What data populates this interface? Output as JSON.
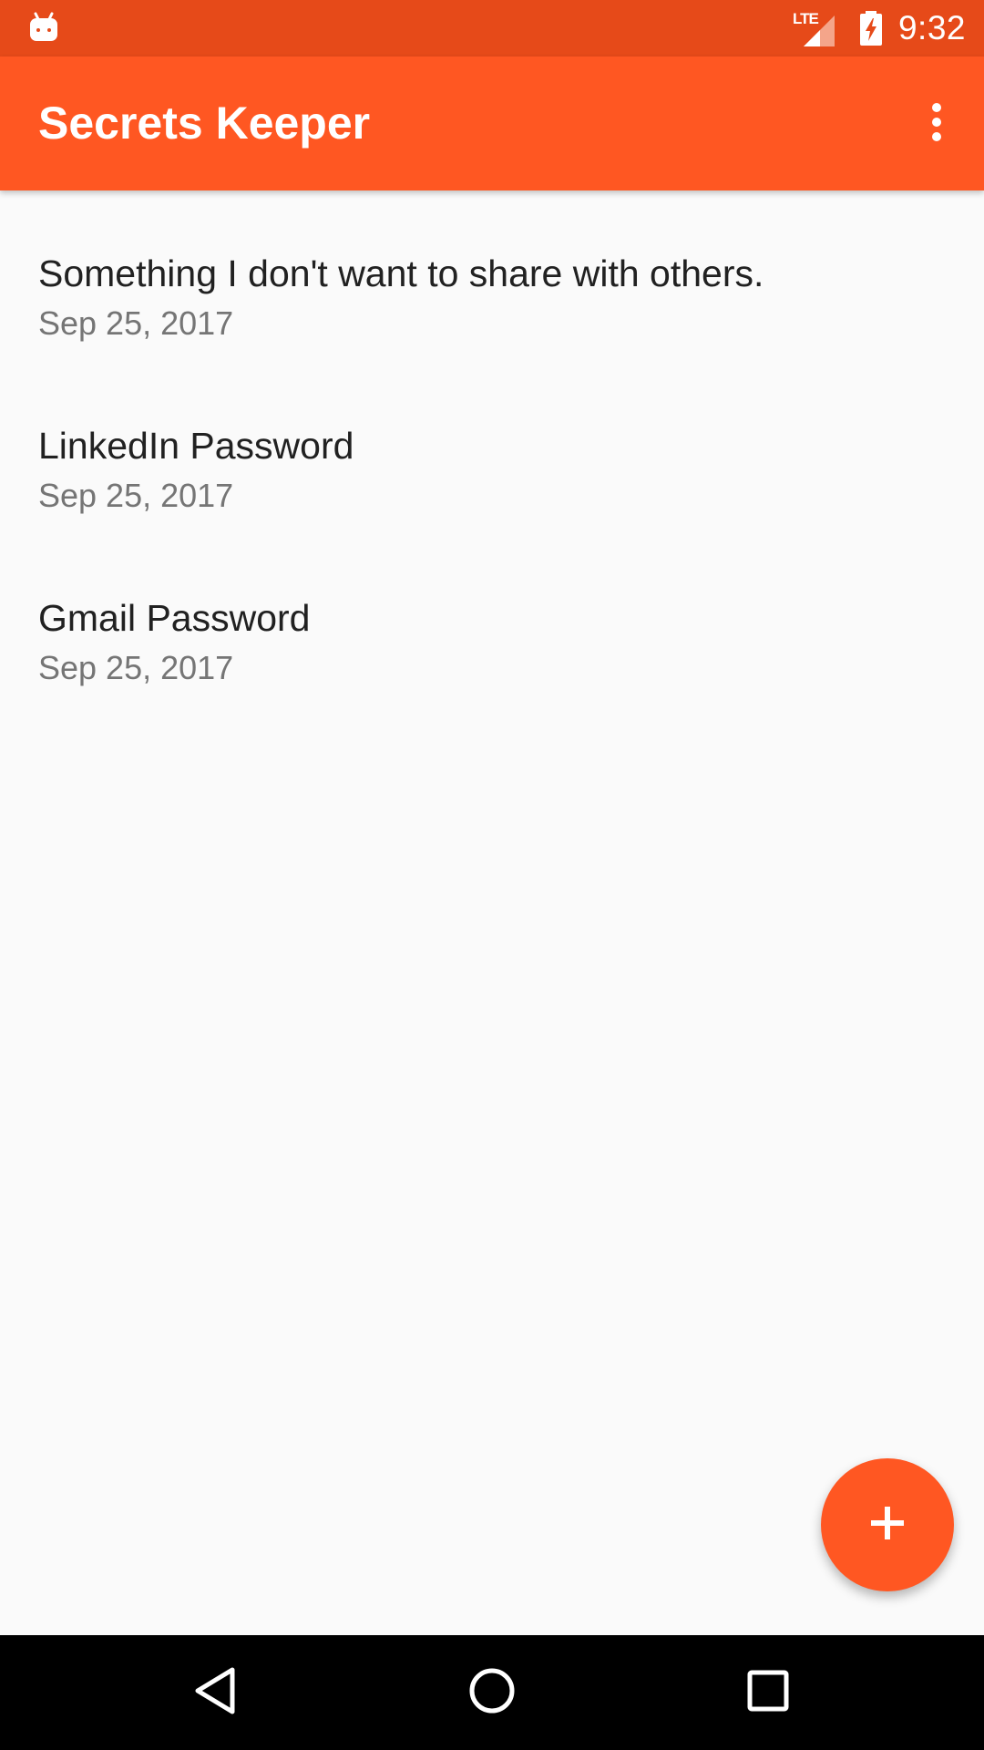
{
  "status_bar": {
    "time": "9:32",
    "network_label": "LTE",
    "left_icon": "android-debug-icon",
    "battery_icon": "battery-charging-icon",
    "signal_icon": "cell-signal-icon"
  },
  "app_bar": {
    "title": "Secrets Keeper",
    "overflow_icon": "more-vert-icon"
  },
  "secrets": [
    {
      "title": "Something I don't want to share with others.",
      "date": "Sep 25, 2017"
    },
    {
      "title": "LinkedIn Password",
      "date": "Sep 25, 2017"
    },
    {
      "title": "Gmail Password",
      "date": "Sep 25, 2017"
    }
  ],
  "fab": {
    "icon": "plus-icon"
  },
  "nav_bar": {
    "back_icon": "back-triangle-icon",
    "home_icon": "home-circle-icon",
    "recents_icon": "recents-square-icon"
  },
  "colors": {
    "status_bar": "#e64a19",
    "app_bar": "#ff5722",
    "accent": "#ff5722",
    "background": "#fafafa",
    "primary_text": "#212121",
    "secondary_text": "#757575",
    "nav_bar": "#000000"
  }
}
